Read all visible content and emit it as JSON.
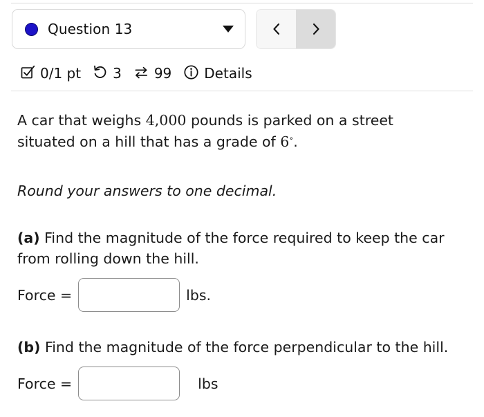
{
  "header": {
    "question_selector": {
      "label": "Question 13",
      "dot_color": "#1c12c8",
      "caret_icon": "chevron-down-icon"
    },
    "prev_label": "‹",
    "next_label": "›"
  },
  "status": {
    "score": "0/1 pt",
    "score_icon": "checkbox-checked-icon",
    "attempts": "3",
    "attempts_icon": "undo-retry-icon",
    "version": "99",
    "version_icon": "swap-arrows-icon",
    "details": "Details",
    "details_icon": "info-circle-icon"
  },
  "problem": {
    "statement_part1": "A car that weighs ",
    "statement_weight": "4,000",
    "statement_part2": " pounds is parked on a street situated on a hill that has a grade of ",
    "statement_angle": "6",
    "statement_degree": "∘",
    "statement_part3": ".",
    "note": "Round your answers to one decimal.",
    "parts": [
      {
        "marker": "(a)",
        "text": " Find the magnitude of the force required to keep the car from rolling down the hill.",
        "answer_label": "Force =",
        "answer_value": "",
        "answer_placeholder": "",
        "unit": "lbs."
      },
      {
        "marker": "(b)",
        "text": " Find the magnitude of the force perpendicular to the hill.",
        "answer_label": "Force =",
        "answer_value": "",
        "answer_placeholder": "",
        "unit": "lbs"
      }
    ]
  }
}
